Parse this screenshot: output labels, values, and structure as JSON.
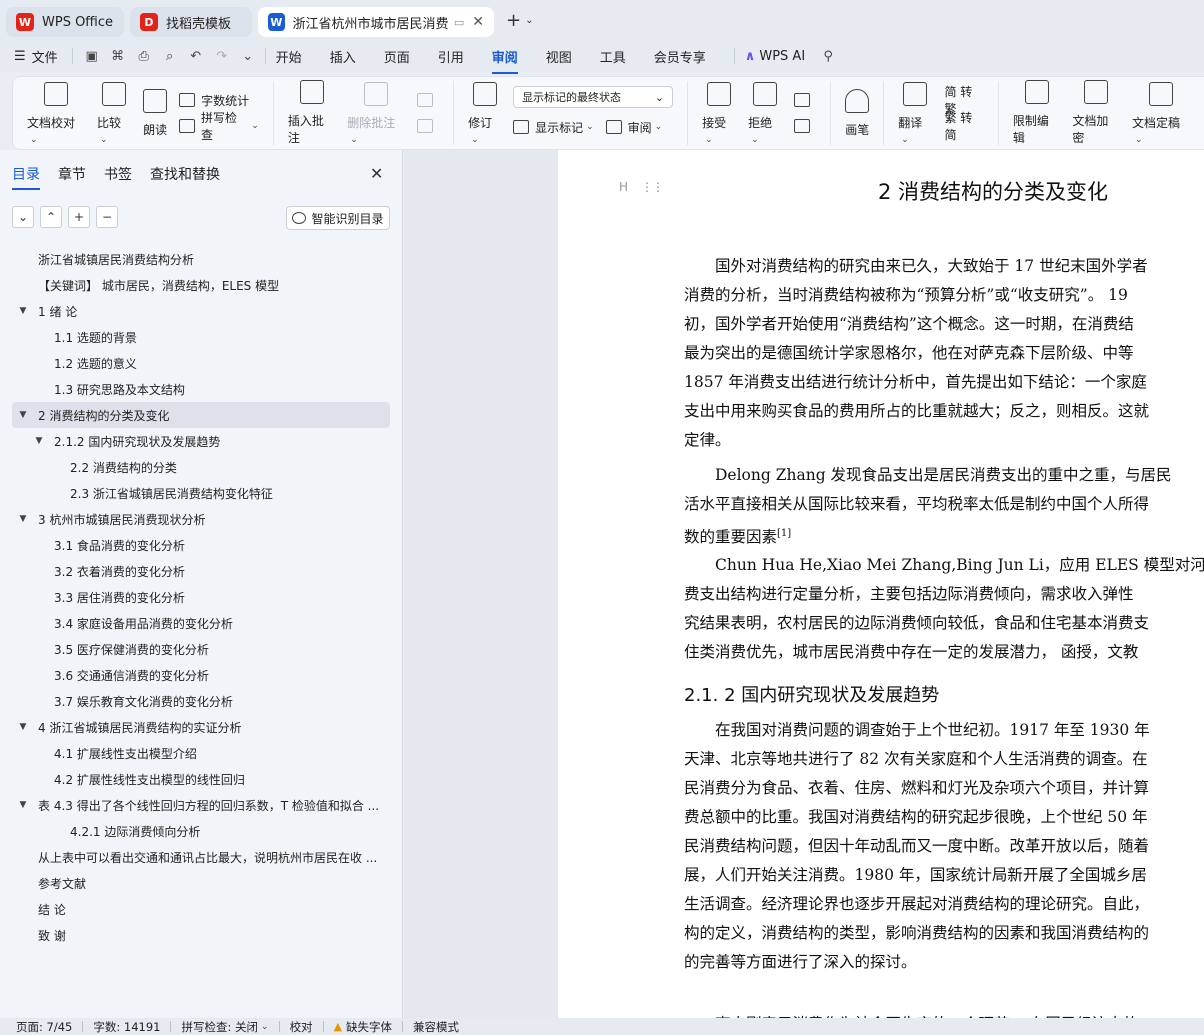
{
  "tabs": [
    {
      "label": "WPS Office",
      "logo": "W",
      "logo_color": "#e2231a"
    },
    {
      "label": "找稻壳模板",
      "logo": "D",
      "logo_color": "#e2231a"
    },
    {
      "label": "浙江省杭州市城市居民消费结",
      "logo": "W",
      "logo_color": "#1a5bd6",
      "active": true
    }
  ],
  "menubar": {
    "file_label": "文件",
    "tabs": [
      "开始",
      "插入",
      "页面",
      "引用",
      "审阅",
      "视图",
      "工具",
      "会员专享"
    ],
    "active_tab": "审阅",
    "ai_label": "WPS AI"
  },
  "ribbon": {
    "doc_check": "文档校对",
    "compare": "比较",
    "read_aloud": "朗读",
    "word_count": "字数统计",
    "spell_check": "拼写检查",
    "insert_comment": "插入批注",
    "delete_comment": "删除批注",
    "revise": "修订",
    "markup_select": "显示标记的最终状态",
    "show_markup": "显示标记",
    "review_pane": "审阅",
    "accept": "接受",
    "reject": "拒绝",
    "pen": "画笔",
    "translate": "翻译",
    "to_traditional": "简 转繁",
    "to_simplified": "繁 转简",
    "restrict_edit": "限制编辑",
    "encrypt": "文档加密",
    "finalize": "文档定稿"
  },
  "left_panel": {
    "tabs": [
      "目录",
      "章节",
      "书签",
      "查找和替换"
    ],
    "active_tab": "目录",
    "smart_toc": "智能识别目录",
    "toc": [
      {
        "level": 1,
        "text": "浙江省城镇居民消费结构分析",
        "arrow": ""
      },
      {
        "level": 1,
        "text": "【关键词】  城市居民，消费结构，ELES 模型",
        "arrow": ""
      },
      {
        "level": 1,
        "text": "1 绪 论",
        "arrow": "▼"
      },
      {
        "level": 2,
        "text": "1.1 选题的背景",
        "arrow": ""
      },
      {
        "level": 2,
        "text": "1.2 选题的意义",
        "arrow": ""
      },
      {
        "level": 2,
        "text": "1.3 研究思路及本文结构",
        "arrow": ""
      },
      {
        "level": 1,
        "text": "2 消费结构的分类及变化",
        "arrow": "▼",
        "selected": true
      },
      {
        "level": 2,
        "text": "2.1.2 国内研究现状及发展趋势",
        "arrow": "▼"
      },
      {
        "level": 3,
        "text": "2.2  消费结构的分类",
        "arrow": ""
      },
      {
        "level": 3,
        "text": "2.3 浙江省城镇居民消费结构变化特征",
        "arrow": ""
      },
      {
        "level": 1,
        "text": "3  杭州市城镇居民消费现状分析",
        "arrow": "▼"
      },
      {
        "level": 2,
        "text": "3.1 食品消费的变化分析",
        "arrow": ""
      },
      {
        "level": 2,
        "text": "3.2 衣着消费的变化分析",
        "arrow": ""
      },
      {
        "level": 2,
        "text": "3.3 居住消费的变化分析",
        "arrow": ""
      },
      {
        "level": 2,
        "text": "3.4 家庭设备用品消费的变化分析",
        "arrow": ""
      },
      {
        "level": 2,
        "text": "3.5 医疗保健消费的变化分析",
        "arrow": ""
      },
      {
        "level": 2,
        "text": "3.6 交通通信消费的变化分析",
        "arrow": ""
      },
      {
        "level": 2,
        "text": "3.7 娱乐教育文化消费的变化分析",
        "arrow": ""
      },
      {
        "level": 1,
        "text": "4  浙江省城镇居民消费结构的实证分析",
        "arrow": "▼"
      },
      {
        "level": 2,
        "text": "4.1  扩展线性支出模型介绍",
        "arrow": ""
      },
      {
        "level": 2,
        "text": "4.2 扩展性线性支出模型的线性回归",
        "arrow": ""
      },
      {
        "level": 1,
        "text": "表 4.3 得出了各个线性回归方程的回归系数，T 检验值和拟合 ...",
        "arrow": "▼"
      },
      {
        "level": 3,
        "text": "4.2.1  边际消费倾向分析",
        "arrow": ""
      },
      {
        "level": 1,
        "text": "从上表中可以看出交通和通讯占比最大，说明杭州市居民在收 ...",
        "arrow": ""
      },
      {
        "level": 1,
        "text": "参考文献",
        "arrow": ""
      },
      {
        "level": 1,
        "text": "结  论",
        "arrow": ""
      },
      {
        "level": 1,
        "text": "致  谢",
        "arrow": ""
      }
    ]
  },
  "document": {
    "heading1": "2 消费结构的分类及变化",
    "heading2": "2.1. 2 国内研究现状及发展趋势",
    "p1": [
      "　　国外对消费结构的研究由来已久，大致始于 17 世纪末国外学者",
      "消费的分析，当时消费结构被称为“预算分析”或“收支研究”。 19",
      "初，国外学者开始使用“消费结构”这个概念。这一时期，在消费结",
      "最为突出的是德国统计学家恩格尔，他在对萨克森下层阶级、中等",
      "1857 年消费支出结进行统计分析中，首先提出如下结论：一个家庭",
      "支出中用来购买食品的费用所占的比重就越大；反之，则相反。这就",
      "定律。"
    ],
    "p2": [
      "　　Delong Zhang 发现食品支出是居民消费支出的重中之重，与居民",
      "活水平直接相关从国际比较来看，平均税率太低是制约中国个人所得",
      "数的重要因素"
    ],
    "p2_ref": "[1]",
    "p3": [
      "　　Chun Hua He,Xiao Mei Zhang,Bing Jun Li，应用 ELES 模型对河",
      "费支出结构进行定量分析，主要包括边际消费倾向，需求收入弹性  ",
      "究结果表明，农村居民的边际消费倾向较低，食品和住宅基本消费支",
      "住类消费优先，城市居民消费中存在一定的发展潜力，  函授，文教"
    ],
    "p4": [
      "　　在我国对消费问题的调查始于上个世纪初。1917 年至  1930  年",
      "天津、北京等地共进行了  82  次有关家庭和个人生活消费的调查。在",
      "民消费分为食品、衣着、住房、燃料和灯光及杂项六个项目，并计算",
      "费总额中的比重。我国对消费结构的研究起步很晚，上个世纪  50  年",
      "民消费结构问题，但因十年动乱而又一度中断。改革开放以后，随着",
      "展，人们开始关注消费。1980 年，国家统计局新开展了全国城乡居",
      "生活调查。经济理论界也逐步开展起对消费结构的理论研究。自此，",
      "构的定义，消费结构的类型，影响消费结构的因素和我国消费结构的",
      "的完善等方面进行了深入的探讨。"
    ],
    "p5": [
      "　　李志刚表示消费作为社会再生产的一个环节 ，在国民经济中的"
    ]
  },
  "status": {
    "page": "页面: 7/45",
    "words": "字数: 14191",
    "spell": "拼写检查: 关闭",
    "proof": "校对",
    "missing_font": "缺失字体",
    "compat": "兼容模式"
  },
  "accent_color": "#1a5bd6"
}
